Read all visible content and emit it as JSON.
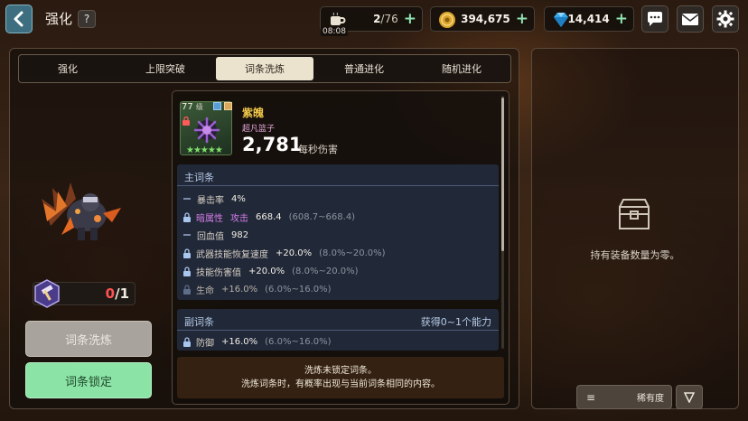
{
  "header": {
    "title": "强化",
    "help_label": "?"
  },
  "resources": {
    "stamina": {
      "current": "2",
      "max": "76",
      "timer": "08:08"
    },
    "gold": "394,675",
    "gems": "14,414"
  },
  "icons": {
    "back": "chevron-left-icon",
    "coffee": "coffee-cup-icon",
    "coin": "gold-coin-icon",
    "gem": "diamond-icon",
    "chat": "chat-bubble-icon",
    "mail": "mail-icon",
    "settings": "gear-icon"
  },
  "tabs": [
    {
      "label": "强化",
      "active": false
    },
    {
      "label": "上限突破",
      "active": false
    },
    {
      "label": "词条洗炼",
      "active": true
    },
    {
      "label": "普通进化",
      "active": false
    },
    {
      "label": "随机进化",
      "active": false
    }
  ],
  "hammer_counter": {
    "current": "0",
    "sep": "/",
    "max": "1"
  },
  "buttons": {
    "wash": "词条洗炼",
    "lock": "词条锁定"
  },
  "item": {
    "level": "77",
    "level_unit": "级",
    "stars": "★★★★★",
    "name": "紫魄",
    "type": "超凡篮子",
    "dps_value": "2,781",
    "dps_label": "每秒伤害"
  },
  "main_stats": {
    "header": "主词条",
    "rows": [
      {
        "name": "暴击率",
        "value": "4%",
        "range": "",
        "locked": false
      },
      {
        "name_a": "暗属性",
        "name_b": "攻击",
        "value": "668.4",
        "range": "(608.7~668.4)",
        "locked": true
      },
      {
        "name": "回血值",
        "value": "982",
        "range": "",
        "locked": false
      },
      {
        "name": "武器技能恢复速度",
        "value": "+20.0%",
        "range": "(8.0%~20.0%)",
        "locked": true
      },
      {
        "name": "技能伤害值",
        "value": "+20.0%",
        "range": "(8.0%~20.0%)",
        "locked": true
      },
      {
        "name": "生命",
        "value": "+16.0%",
        "range": "(6.0%~16.0%)",
        "locked": true
      }
    ]
  },
  "sub_stats": {
    "header": "副词条",
    "hint": "获得0~1个能力",
    "rows": [
      {
        "name": "防御",
        "value": "+16.0%",
        "range": "(6.0%~16.0%)",
        "locked": true
      }
    ]
  },
  "notice": {
    "line1": "洗炼未锁定词条。",
    "line2": "洗炼词条时，有概率出现与当前词条相同的内容。"
  },
  "inventory": {
    "empty_message": "持有装备数量为零。",
    "sort_label": "稀有度"
  },
  "colors": {
    "accent_green": "#8be3a5",
    "gold_text": "#f0c64a",
    "purple_text": "#d57de9",
    "red_text": "#ff5252"
  }
}
